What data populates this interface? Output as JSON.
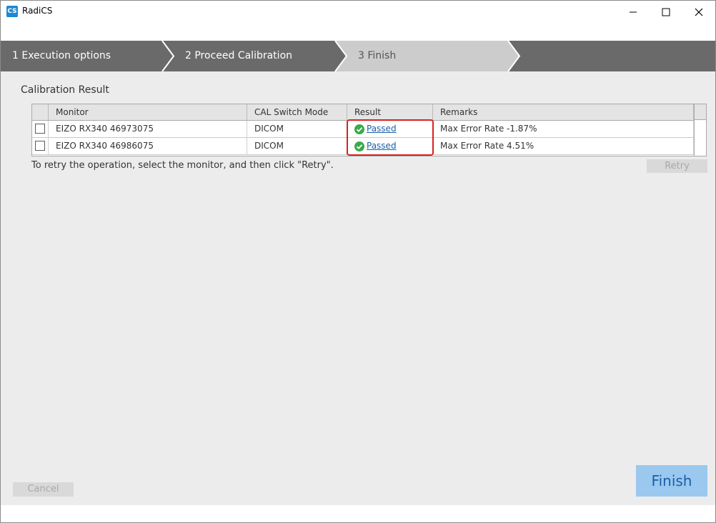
{
  "window": {
    "app_icon_text": "CS",
    "title": "RadiCS"
  },
  "steps": [
    {
      "label": "1  Execution options",
      "state": "done"
    },
    {
      "label": "2  Proceed Calibration",
      "state": "done"
    },
    {
      "label": "3  Finish",
      "state": "current"
    }
  ],
  "main": {
    "section_title": "Calibration Result",
    "columns": [
      "Monitor",
      "CAL Switch Mode",
      "Result",
      "Remarks"
    ],
    "rows": [
      {
        "checked": false,
        "monitor": "EIZO RX340 46973075",
        "mode": "DICOM",
        "result": "Passed",
        "remarks": "Max Error Rate -1.87%"
      },
      {
        "checked": false,
        "monitor": "EIZO RX340 46986075",
        "mode": "DICOM",
        "result": "Passed",
        "remarks": "Max Error Rate 4.51%"
      }
    ],
    "note": "To retry the operation, select the monitor, and then click \"Retry\".",
    "retry_label": "Retry"
  },
  "footer": {
    "cancel_label": "Cancel",
    "finish_label": "Finish"
  },
  "colors": {
    "steps_bar": "#6a6a6a",
    "current_step": "#cccccc",
    "highlight": "#d92020",
    "passed_icon": "#3aaa4a",
    "link": "#1a5fa8",
    "finish_button": "#9bc8ee"
  }
}
